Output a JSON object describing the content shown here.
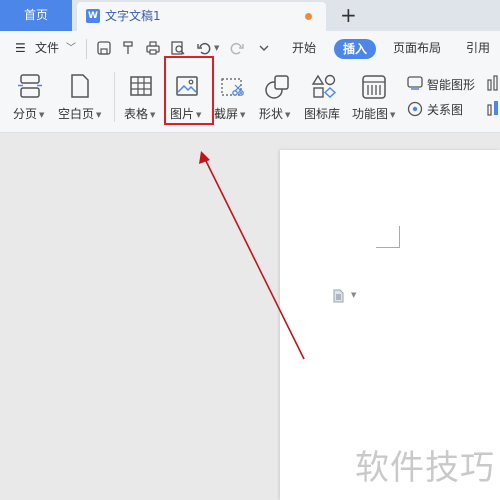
{
  "tabs": {
    "home_label": "首页",
    "doc_title": "文字文稿1",
    "doc_icon_letter": "W",
    "new_tab_symbol": "+"
  },
  "menu": {
    "hamburger_symbol": "☰",
    "file_label": "文件",
    "items": [
      "开始",
      "插入",
      "页面布局",
      "引用"
    ],
    "active_item": "插入"
  },
  "ribbon": {
    "page_break": "分页",
    "blank_page": "空白页",
    "table": "表格",
    "picture": "图片",
    "screenshot": "截屏",
    "shape": "形状",
    "icon_library": "图标库",
    "function_chart": "功能图",
    "smart_graphic": "智能图形",
    "relation_chart": "关系图"
  },
  "annotation": {
    "highlight_color": "#e02020",
    "arrow_color": "#c0141b"
  },
  "watermark": "软件技巧",
  "colors": {
    "accent": "#4d86e9",
    "unsaved_dot": "#ef8b3f"
  }
}
